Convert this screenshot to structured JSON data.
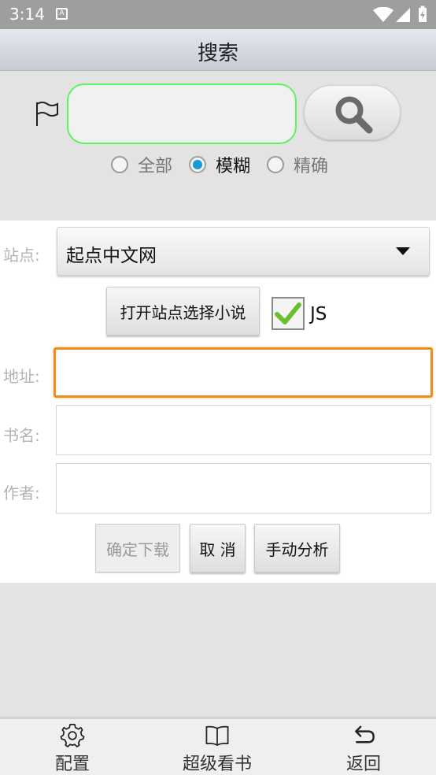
{
  "status_bar": {
    "time": "3:14",
    "notification_icon": "a-icon"
  },
  "header": {
    "title": "搜索"
  },
  "search": {
    "query_value": "",
    "radio_options": [
      {
        "label": "全部",
        "selected": false
      },
      {
        "label": "模糊",
        "selected": true
      },
      {
        "label": "精确",
        "selected": false
      }
    ]
  },
  "form": {
    "site_label": "站点:",
    "site_value": "起点中文网",
    "open_site_button": "打开站点选择小说",
    "js_checked": true,
    "js_label": "JS",
    "address_label": "地址:",
    "address_value": "",
    "book_label": "书名:",
    "book_value": "",
    "author_label": "作者:",
    "author_value": "",
    "confirm_download": "确定下载",
    "cancel": "取 消",
    "manual_analysis": "手动分析"
  },
  "bottom_nav": {
    "items": [
      {
        "label": "配置",
        "icon": "gear-icon"
      },
      {
        "label": "超级看书",
        "icon": "book-icon"
      },
      {
        "label": "返回",
        "icon": "back-icon"
      }
    ]
  },
  "colors": {
    "accent": "#5ef25e",
    "focus": "#f08d1a",
    "radio_selected": "#1a9ad8"
  }
}
